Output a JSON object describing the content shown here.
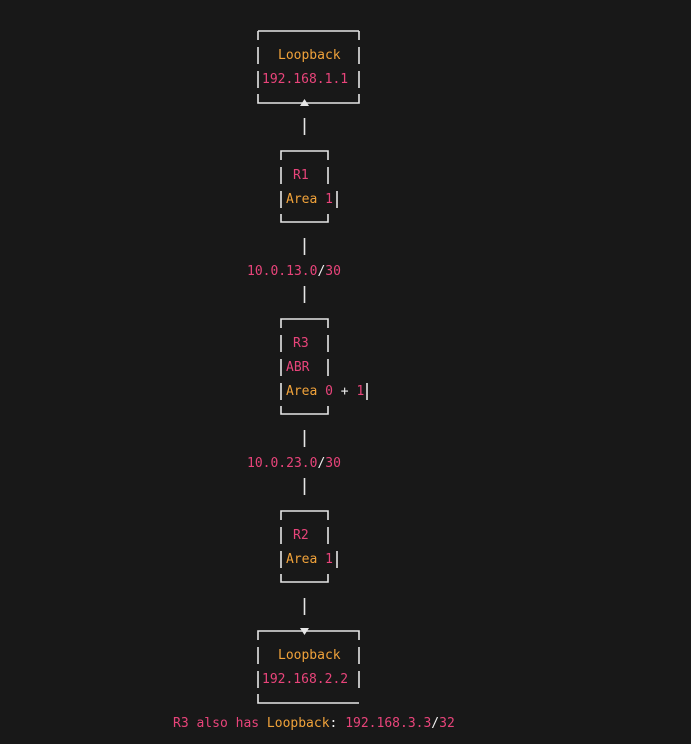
{
  "colors": {
    "background": "#181818",
    "line": "#e6e6e6",
    "pink": "#e8447a",
    "orange": "#f0a23a"
  },
  "nodes": {
    "loopback_top": {
      "title": "Loopback",
      "ip": "192.168.1.1"
    },
    "r1": {
      "name": "R1",
      "area_label": "Area",
      "area_num": "1"
    },
    "r3": {
      "name": "R3",
      "role": "ABR",
      "area_label": "Area",
      "area_a": "0",
      "plus": "+",
      "area_b": "1"
    },
    "r2": {
      "name": "R2",
      "area_label": "Area",
      "area_num": "1"
    },
    "loopback_bottom": {
      "title": "Loopback",
      "ip": "192.168.2.2"
    }
  },
  "links": {
    "subnet_1": {
      "net": "10.0.13.0",
      "slash": "/",
      "mask": "30"
    },
    "subnet_2": {
      "net": "10.0.23.0",
      "slash": "/",
      "mask": "30"
    }
  },
  "note": {
    "prefix": "R3 also has",
    "keyword": "Loopback",
    "colon": ":",
    "ip": "192.168.3.3",
    "slash": "/",
    "mask": "32"
  }
}
